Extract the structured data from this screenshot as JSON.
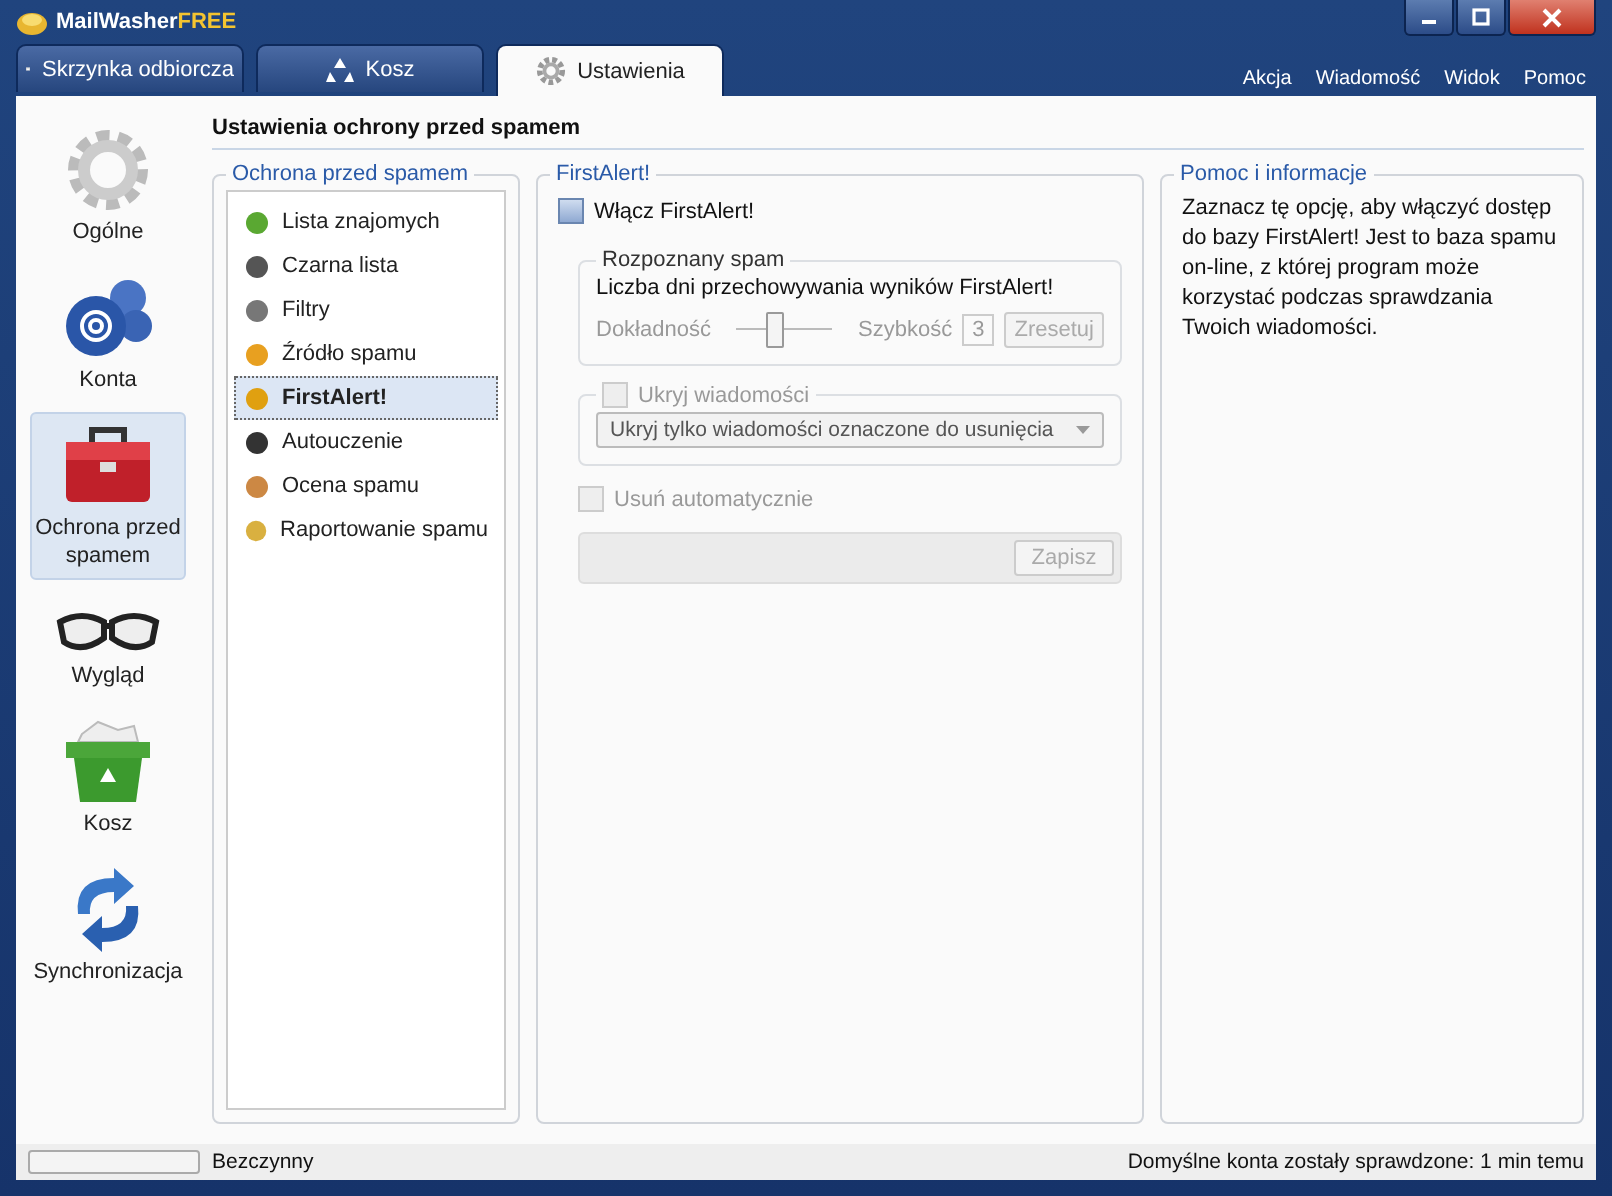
{
  "window": {
    "app_name": "MailWasher",
    "edition": "FREE"
  },
  "tabs": [
    {
      "label": "Skrzynka odbiorcza",
      "selected": false
    },
    {
      "label": "Kosz",
      "selected": false
    },
    {
      "label": "Ustawienia",
      "selected": true
    }
  ],
  "menu": [
    "Akcja",
    "Wiadomość",
    "Widok",
    "Pomoc"
  ],
  "nav": [
    {
      "label": "Ogólne",
      "selected": false
    },
    {
      "label": "Konta",
      "selected": false
    },
    {
      "label": "Ochrona przed spamem",
      "selected": true
    },
    {
      "label": "Wygląd",
      "selected": false
    },
    {
      "label": "Kosz",
      "selected": false
    },
    {
      "label": "Synchronizacja",
      "selected": false
    }
  ],
  "page_title": "Ustawienia ochrony przed spamem",
  "list_group": {
    "title": "Ochrona przed spamem",
    "items": [
      {
        "label": "Lista znajomych",
        "selected": false
      },
      {
        "label": "Czarna lista",
        "selected": false
      },
      {
        "label": "Filtry",
        "selected": false
      },
      {
        "label": "Źródło spamu",
        "selected": false
      },
      {
        "label": "FirstAlert!",
        "selected": true
      },
      {
        "label": "Autouczenie",
        "selected": false
      },
      {
        "label": "Ocena spamu",
        "selected": false
      },
      {
        "label": "Raportowanie spamu",
        "selected": false
      }
    ]
  },
  "firstalert": {
    "title": "FirstAlert!",
    "enable": {
      "label": "Włącz FirstAlert!",
      "checked": false,
      "disabled": false
    },
    "spam_group": {
      "title": "Rozpoznany spam",
      "description": "Liczba dni przechowywania wyników FirstAlert!",
      "left_label": "Dokładność",
      "right_label": "Szybkość",
      "level": 0.42,
      "value": "3",
      "reset": {
        "label": "Zresetuj",
        "disabled": true
      }
    },
    "hide": {
      "label": "Ukryj wiadomości",
      "checked": false,
      "disabled": true,
      "dropdown": "Ukryj tylko wiadomości oznaczone do usunięcia"
    },
    "auto_delete": {
      "label": "Usuń automatycznie",
      "checked": false,
      "disabled": true
    },
    "save": {
      "label": "Zapisz",
      "disabled": true
    }
  },
  "help": {
    "title": "Pomoc i informacje",
    "text": "Zaznacz tę opcję, aby włączyć dostęp do bazy FirstAlert! Jest to baza spamu on-line, z której program może korzystać podczas sprawdzania Twoich wiadomości."
  },
  "status_bar": {
    "level": 0,
    "status": "Bezczynny",
    "info": "Domyślne konta zostały sprawdzone: 1 min temu"
  }
}
